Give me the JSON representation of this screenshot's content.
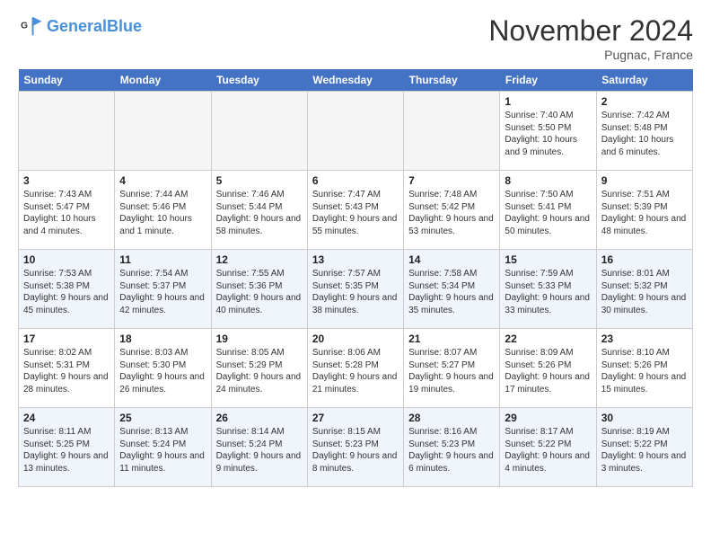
{
  "header": {
    "logo_general": "General",
    "logo_blue": "Blue",
    "month_title": "November 2024",
    "location": "Pugnac, France"
  },
  "days_of_week": [
    "Sunday",
    "Monday",
    "Tuesday",
    "Wednesday",
    "Thursday",
    "Friday",
    "Saturday"
  ],
  "weeks": [
    [
      {
        "day": "",
        "info": ""
      },
      {
        "day": "",
        "info": ""
      },
      {
        "day": "",
        "info": ""
      },
      {
        "day": "",
        "info": ""
      },
      {
        "day": "",
        "info": ""
      },
      {
        "day": "1",
        "info": "Sunrise: 7:40 AM\nSunset: 5:50 PM\nDaylight: 10 hours and 9 minutes."
      },
      {
        "day": "2",
        "info": "Sunrise: 7:42 AM\nSunset: 5:48 PM\nDaylight: 10 hours and 6 minutes."
      }
    ],
    [
      {
        "day": "3",
        "info": "Sunrise: 7:43 AM\nSunset: 5:47 PM\nDaylight: 10 hours and 4 minutes."
      },
      {
        "day": "4",
        "info": "Sunrise: 7:44 AM\nSunset: 5:46 PM\nDaylight: 10 hours and 1 minute."
      },
      {
        "day": "5",
        "info": "Sunrise: 7:46 AM\nSunset: 5:44 PM\nDaylight: 9 hours and 58 minutes."
      },
      {
        "day": "6",
        "info": "Sunrise: 7:47 AM\nSunset: 5:43 PM\nDaylight: 9 hours and 55 minutes."
      },
      {
        "day": "7",
        "info": "Sunrise: 7:48 AM\nSunset: 5:42 PM\nDaylight: 9 hours and 53 minutes."
      },
      {
        "day": "8",
        "info": "Sunrise: 7:50 AM\nSunset: 5:41 PM\nDaylight: 9 hours and 50 minutes."
      },
      {
        "day": "9",
        "info": "Sunrise: 7:51 AM\nSunset: 5:39 PM\nDaylight: 9 hours and 48 minutes."
      }
    ],
    [
      {
        "day": "10",
        "info": "Sunrise: 7:53 AM\nSunset: 5:38 PM\nDaylight: 9 hours and 45 minutes."
      },
      {
        "day": "11",
        "info": "Sunrise: 7:54 AM\nSunset: 5:37 PM\nDaylight: 9 hours and 42 minutes."
      },
      {
        "day": "12",
        "info": "Sunrise: 7:55 AM\nSunset: 5:36 PM\nDaylight: 9 hours and 40 minutes."
      },
      {
        "day": "13",
        "info": "Sunrise: 7:57 AM\nSunset: 5:35 PM\nDaylight: 9 hours and 38 minutes."
      },
      {
        "day": "14",
        "info": "Sunrise: 7:58 AM\nSunset: 5:34 PM\nDaylight: 9 hours and 35 minutes."
      },
      {
        "day": "15",
        "info": "Sunrise: 7:59 AM\nSunset: 5:33 PM\nDaylight: 9 hours and 33 minutes."
      },
      {
        "day": "16",
        "info": "Sunrise: 8:01 AM\nSunset: 5:32 PM\nDaylight: 9 hours and 30 minutes."
      }
    ],
    [
      {
        "day": "17",
        "info": "Sunrise: 8:02 AM\nSunset: 5:31 PM\nDaylight: 9 hours and 28 minutes."
      },
      {
        "day": "18",
        "info": "Sunrise: 8:03 AM\nSunset: 5:30 PM\nDaylight: 9 hours and 26 minutes."
      },
      {
        "day": "19",
        "info": "Sunrise: 8:05 AM\nSunset: 5:29 PM\nDaylight: 9 hours and 24 minutes."
      },
      {
        "day": "20",
        "info": "Sunrise: 8:06 AM\nSunset: 5:28 PM\nDaylight: 9 hours and 21 minutes."
      },
      {
        "day": "21",
        "info": "Sunrise: 8:07 AM\nSunset: 5:27 PM\nDaylight: 9 hours and 19 minutes."
      },
      {
        "day": "22",
        "info": "Sunrise: 8:09 AM\nSunset: 5:26 PM\nDaylight: 9 hours and 17 minutes."
      },
      {
        "day": "23",
        "info": "Sunrise: 8:10 AM\nSunset: 5:26 PM\nDaylight: 9 hours and 15 minutes."
      }
    ],
    [
      {
        "day": "24",
        "info": "Sunrise: 8:11 AM\nSunset: 5:25 PM\nDaylight: 9 hours and 13 minutes."
      },
      {
        "day": "25",
        "info": "Sunrise: 8:13 AM\nSunset: 5:24 PM\nDaylight: 9 hours and 11 minutes."
      },
      {
        "day": "26",
        "info": "Sunrise: 8:14 AM\nSunset: 5:24 PM\nDaylight: 9 hours and 9 minutes."
      },
      {
        "day": "27",
        "info": "Sunrise: 8:15 AM\nSunset: 5:23 PM\nDaylight: 9 hours and 8 minutes."
      },
      {
        "day": "28",
        "info": "Sunrise: 8:16 AM\nSunset: 5:23 PM\nDaylight: 9 hours and 6 minutes."
      },
      {
        "day": "29",
        "info": "Sunrise: 8:17 AM\nSunset: 5:22 PM\nDaylight: 9 hours and 4 minutes."
      },
      {
        "day": "30",
        "info": "Sunrise: 8:19 AM\nSunset: 5:22 PM\nDaylight: 9 hours and 3 minutes."
      }
    ]
  ]
}
